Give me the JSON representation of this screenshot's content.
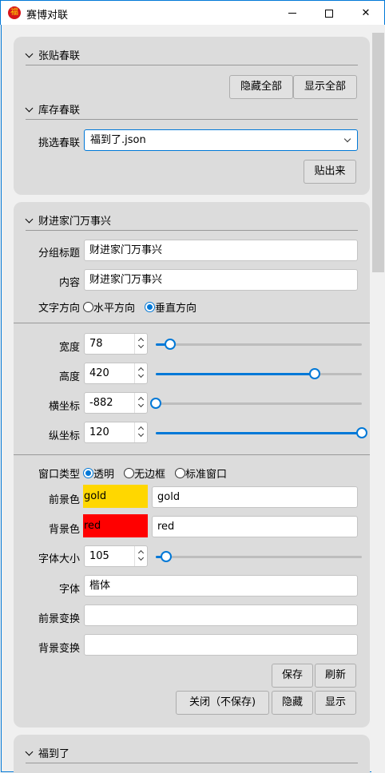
{
  "window": {
    "title": "赛博对联",
    "icon_char": "福",
    "min_glyph": "",
    "close_glyph": "✕"
  },
  "panel1": {
    "header1": "张贴春联",
    "hide_all": "隐藏全部",
    "show_all": "显示全部",
    "header2": "库存春联",
    "pick_label": "挑选春联",
    "pick_value": "福到了.json",
    "post_button": "贴出来"
  },
  "panel2": {
    "header": "财进家门万事兴",
    "group_title_label": "分组标题",
    "group_title_value": "财进家门万事兴",
    "content_label": "内容",
    "content_value": "财进家门万事兴",
    "direction_label": "文字方向",
    "direction_options": [
      "水平方向",
      "垂直方向"
    ],
    "direction_selected": "垂直方向",
    "width_label": "宽度",
    "width_value": "78",
    "width_fraction": 0.07,
    "height_label": "高度",
    "height_value": "420",
    "height_fraction": 0.77,
    "x_label": "横坐标",
    "x_value": "-882",
    "x_fraction": 0.0,
    "y_label": "纵坐标",
    "y_value": "120",
    "y_fraction": 1.0,
    "window_type_label": "窗口类型",
    "window_type_options": [
      "透明",
      "无边框",
      "标准窗口"
    ],
    "window_type_selected": "透明",
    "fg_label": "前景色",
    "fg_swatch_text": "gold",
    "fg_value": "gold",
    "fg_color": "#ffd700",
    "bg_label": "背景色",
    "bg_swatch_text": "red",
    "bg_value": "red",
    "bg_color": "#ff0000",
    "font_size_label": "字体大小",
    "font_size_value": "105",
    "font_size_fraction": 0.05,
    "font_label": "字体",
    "font_value": "楷体",
    "fg_transform_label": "前景变换",
    "fg_transform_value": "",
    "bg_transform_label": "背景变换",
    "bg_transform_value": "",
    "save_button": "保存",
    "refresh_button": "刷新",
    "close_nosave_button": "关闭（不保存)",
    "hide_button": "隐藏",
    "show_button": "显示"
  },
  "panel3": {
    "header": "福到了"
  },
  "colors": {
    "accent": "#0078d7",
    "panel": "#dcdcdc"
  }
}
